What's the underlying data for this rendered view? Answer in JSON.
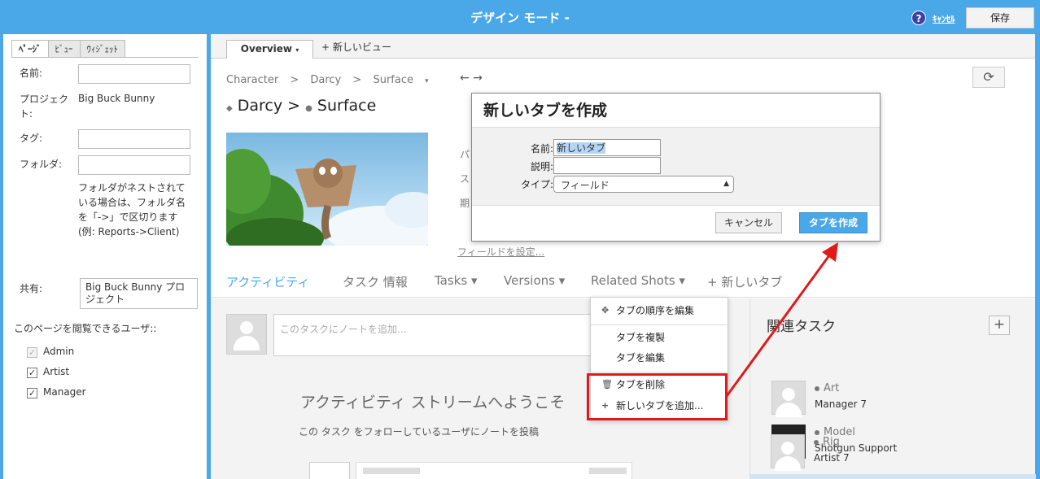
{
  "app": {
    "title": "デザイン モード -",
    "help_icon": "?",
    "cancel_label": "ｷｬﾝｾﾙ",
    "save_label": "保存"
  },
  "left_panel": {
    "tabs": [
      "ﾍﾟｰｼﾞ",
      "ﾋﾞｭｰ",
      "ｳｨｼﾞｪｯﾄ"
    ],
    "name_label": "名前:",
    "name_value": "",
    "project_label": "プロジェクト:",
    "project_value": "Big Buck Bunny",
    "tag_label": "タグ:",
    "folder_label": "フォルダ:",
    "folder_help": "フォルダがネストされている場合は、フォルダ名を「->」で区切ります(例: Reports->Client)",
    "share_label": "共有:",
    "share_value": "Big Buck Bunny プロジェクト",
    "viewers_label": "このページを閲覧できるユーザ::",
    "viewers": [
      {
        "label": "Admin",
        "checked": true,
        "disabled": true
      },
      {
        "label": "Artist",
        "checked": true,
        "disabled": false
      },
      {
        "label": "Manager",
        "checked": true,
        "disabled": false
      }
    ]
  },
  "main": {
    "view_tab": "Overview",
    "view_tab_caret": "▾",
    "new_view": "+ 新しいビュー",
    "breadcrumb": [
      "Character",
      ">",
      "Darcy",
      ">",
      "Surface",
      "▾"
    ],
    "history_arrows": "← →",
    "refresh_icon": "⟳",
    "title_entity": "Darcy",
    "title_sep": ">",
    "title_task": "Surface",
    "side_labels": [
      "パ",
      "ス",
      "期"
    ],
    "fields_link": "フィールドを設定...",
    "content_tabs": [
      {
        "label": "アクティビティ",
        "active": true
      },
      {
        "label": "タスク 情報",
        "active": false
      },
      {
        "label": "Tasks ▾",
        "active": false
      },
      {
        "label": "Versions ▾",
        "active": false
      },
      {
        "label": "Related Shots ▾",
        "active": false
      },
      {
        "label": "+ 新しいタブ",
        "active": false
      }
    ],
    "note_placeholder": "このタスクにノートを追加...",
    "welcome": "アクティビティ ストリームへようこそ",
    "welcome_sub": "この タスク をフォローしているユーザにノートを投稿"
  },
  "related": {
    "title": "関連タスク",
    "add_label": "+",
    "items": [
      {
        "name": "Art",
        "sub": "Manager 7",
        "avatar": ""
      },
      {
        "name": "Model",
        "sub": "Shotgun Support",
        "avatar": "SG"
      },
      {
        "name": "Rig",
        "sub": "Artist 7",
        "avatar": ""
      }
    ]
  },
  "dropdown": {
    "items": [
      {
        "icon": "✥",
        "label": "タブの順序を編集"
      },
      {
        "icon": "",
        "label": "タブを複製"
      },
      {
        "icon": "",
        "label": "タブを編集"
      },
      {
        "icon": "🗑",
        "label": "タブを削除"
      },
      {
        "icon": "+",
        "label": "新しいタブを追加..."
      }
    ]
  },
  "dialog": {
    "title": "新しいタブを作成",
    "name_label": "名前:",
    "name_value": "新しいタブ",
    "desc_label": "説明:",
    "desc_value": "",
    "type_label": "タイプ:",
    "type_value": "フィールド",
    "cancel": "キャンセル",
    "create": "タブを作成"
  },
  "colors": {
    "accent": "#4aa8e8",
    "annotation": "#e01a1a"
  }
}
